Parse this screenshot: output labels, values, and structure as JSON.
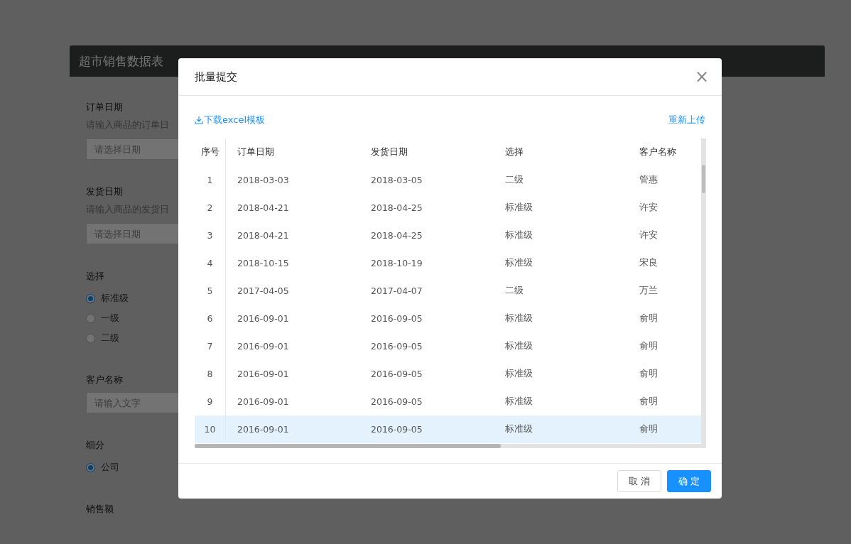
{
  "page": {
    "title": "超市销售数据表",
    "fields": [
      {
        "kind": "input",
        "label": "订单日期",
        "hint": "请输入商品的订单日",
        "placeholder": "请选择日期"
      },
      {
        "kind": "input",
        "label": "发货日期",
        "hint": "请输入商品的发货日",
        "placeholder": "请选择日期"
      },
      {
        "kind": "radio",
        "label": "选择",
        "options": [
          {
            "label": "标准级",
            "selected": true
          },
          {
            "label": "一级",
            "selected": false
          },
          {
            "label": "二级",
            "selected": false
          }
        ]
      },
      {
        "kind": "input",
        "label": "客户名称",
        "placeholder": "请输入文字"
      },
      {
        "kind": "radio",
        "label": "细分",
        "options": [
          {
            "label": "公司",
            "selected": true
          }
        ]
      },
      {
        "kind": "label",
        "label": "销售额"
      }
    ]
  },
  "dialog": {
    "title": "批量提交",
    "close": "×",
    "download_link": "下载excel模板",
    "reupload_link": "重新上传",
    "table": {
      "columns": [
        "序号",
        "订单日期",
        "发货日期",
        "选择",
        "客户名称"
      ],
      "rows": [
        {
          "cells": [
            "1",
            "2018-03-03",
            "2018-03-05",
            "二级",
            "管惠"
          ],
          "selected": false
        },
        {
          "cells": [
            "2",
            "2018-04-21",
            "2018-04-25",
            "标准级",
            "许安"
          ],
          "selected": false
        },
        {
          "cells": [
            "3",
            "2018-04-21",
            "2018-04-25",
            "标准级",
            "许安"
          ],
          "selected": false
        },
        {
          "cells": [
            "4",
            "2018-10-15",
            "2018-10-19",
            "标准级",
            "宋良"
          ],
          "selected": false
        },
        {
          "cells": [
            "5",
            "2017-04-05",
            "2017-04-07",
            "二级",
            "万兰"
          ],
          "selected": false
        },
        {
          "cells": [
            "6",
            "2016-09-01",
            "2016-09-05",
            "标准级",
            "俞明"
          ],
          "selected": false
        },
        {
          "cells": [
            "7",
            "2016-09-01",
            "2016-09-05",
            "标准级",
            "俞明"
          ],
          "selected": false
        },
        {
          "cells": [
            "8",
            "2016-09-01",
            "2016-09-05",
            "标准级",
            "俞明"
          ],
          "selected": false
        },
        {
          "cells": [
            "9",
            "2016-09-01",
            "2016-09-05",
            "标准级",
            "俞明"
          ],
          "selected": false
        },
        {
          "cells": [
            "10",
            "2016-09-01",
            "2016-09-05",
            "标准级",
            "俞明"
          ],
          "selected": true
        }
      ]
    },
    "buttons": [
      {
        "label": "取 消",
        "kind": "default"
      },
      {
        "label": "确 定",
        "kind": "primary"
      }
    ]
  }
}
